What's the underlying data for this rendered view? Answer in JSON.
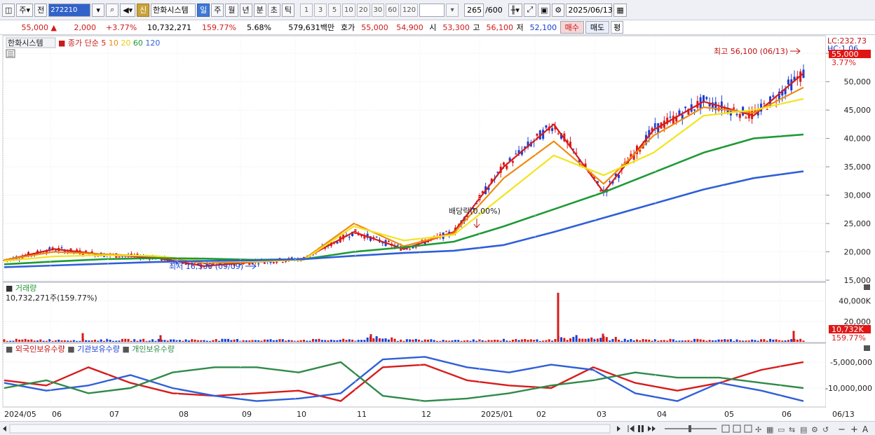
{
  "toolbar": {
    "layout_label": "주",
    "prev_label": "전",
    "stock_code": "272210",
    "shin_label": "신",
    "stock_name": "한화시스템",
    "periods": [
      "일",
      "주",
      "월",
      "년",
      "분",
      "초",
      "틱"
    ],
    "selected_period": "일",
    "minute_options": [
      "1",
      "3",
      "5",
      "10",
      "20",
      "30",
      "60",
      "120"
    ],
    "count": "265",
    "max_count": "/600",
    "date": "2025/06/13"
  },
  "quote": {
    "price": "55,000",
    "change": "2,000",
    "change_pct": "+3.77%",
    "volume": "10,732,271",
    "volume_pct": "159.77%",
    "turnover_rate": "5.68%",
    "amount": "579,631백만",
    "bid_ask_label": "호가",
    "ask": "55,000",
    "bid": "54,900",
    "open_label": "시",
    "open": "53,300",
    "high_label": "고",
    "high": "56,100",
    "low_label": "저",
    "low": "52,100",
    "buy_label": "매수",
    "sell_label": "매도",
    "eval_label": "평"
  },
  "price_panel": {
    "stock_label": "한화시스템",
    "ma_label": "종가 단순",
    "ma_periods": [
      "5",
      "10",
      "20",
      "60",
      "120"
    ],
    "ma_colors": [
      "#d81b1b",
      "#ef8a12",
      "#f2e41c",
      "#1e9a36",
      "#2f5fd8"
    ],
    "lc_label": "LC:232.73",
    "hc_label": "HC:1.06",
    "current_price_tag": "55,000",
    "current_pct_tag": "3.77%",
    "high_annotation": "최고 56,100 (06/13)",
    "low_annotation": "최저 16,530 (09/09)",
    "dividend_annotation": "배당락(0.00%)"
  },
  "volume_panel": {
    "title": "거래량",
    "summary": "10,732,271주(159.77%)",
    "current_tag": "10,732K",
    "current_pct_tag": "159.77%"
  },
  "holding_panel": {
    "legend": [
      "외국인보유수량",
      "기관보유수량",
      "개인보유수량"
    ],
    "colors": [
      "#d81b1b",
      "#2f5fd8",
      "#2f8a4a"
    ]
  },
  "x_labels": [
    "2024/05",
    "06",
    "07",
    "08",
    "09",
    "10",
    "11",
    "12",
    "2025/01",
    "02",
    "03",
    "04",
    "05",
    "06",
    "06/13"
  ],
  "chart_data": [
    {
      "type": "line",
      "title": "",
      "x": [
        "2024/05",
        "06",
        "07",
        "08",
        "09",
        "10",
        "11",
        "12",
        "2025/01",
        "02",
        "03",
        "04",
        "05",
        "06",
        "06/13"
      ],
      "ylim": [
        15000,
        57000
      ],
      "y_ticks": [
        15000,
        20000,
        25000,
        30000,
        35000,
        40000,
        45000,
        50000,
        55000
      ],
      "y_tick_labels": [
        "15,000",
        "20,000",
        "25,000",
        "30,000",
        "35,000",
        "40,000",
        "45,000",
        "50,000",
        "55,000"
      ],
      "series": [
        {
          "name": "5",
          "values": [
            18500,
            20500,
            19500,
            19000,
            17500,
            18200,
            18800,
            23500,
            20500,
            23500,
            35000,
            42500,
            30500,
            41500,
            46500,
            44000,
            51500
          ]
        },
        {
          "name": "10",
          "values": [
            18600,
            20000,
            19600,
            19200,
            18000,
            18200,
            18700,
            25000,
            21000,
            23300,
            33000,
            39500,
            32000,
            40500,
            45500,
            44500,
            49000
          ]
        },
        {
          "name": "20",
          "values": [
            18400,
            19200,
            19400,
            19300,
            18400,
            18300,
            18600,
            24500,
            22000,
            23000,
            30000,
            37000,
            33500,
            37500,
            44000,
            45000,
            47000
          ]
        },
        {
          "name": "60",
          "values": [
            17800,
            18300,
            18700,
            18900,
            18800,
            18600,
            18700,
            20000,
            20800,
            21800,
            24500,
            27500,
            30500,
            34000,
            37500,
            40000,
            40700
          ]
        },
        {
          "name": "120",
          "values": [
            17300,
            17600,
            17900,
            18200,
            18400,
            18500,
            18700,
            19300,
            19800,
            20200,
            21200,
            23500,
            26000,
            28500,
            31000,
            33000,
            34200
          ]
        }
      ],
      "high": 56100,
      "low": 16530
    },
    {
      "type": "bar",
      "title": "",
      "ylim": [
        0,
        50000
      ],
      "y_ticks": [
        20000,
        40000
      ],
      "y_tick_labels": [
        "20,000",
        "40,000K"
      ],
      "spikes": [
        {
          "x": "2024/06",
          "value": 8500
        },
        {
          "x": "2024/07",
          "value": 6500
        },
        {
          "x": "2024/11",
          "value": 7500
        },
        {
          "x": "2025/02",
          "value": 48000
        },
        {
          "x": "2025/03",
          "value": 8000
        },
        {
          "x": "2025/06/13",
          "value": 10732
        }
      ]
    },
    {
      "type": "line",
      "title": "",
      "ylim": [
        -13500,
        -3000
      ],
      "y_ticks": [
        -5000000,
        -10000000
      ],
      "y_tick_labels": [
        "-5,000,000",
        "-10,000,000"
      ],
      "series": [
        {
          "name": "외국인보유수량",
          "values": [
            -8.5,
            -9.5,
            -6.0,
            -9.0,
            -11.0,
            -11.5,
            -11.0,
            -10.5,
            -12.5,
            -6.0,
            -5.5,
            -8.5,
            -9.5,
            -10.0,
            -6.0,
            -9.0,
            -10.5,
            -9.0,
            -6.5,
            -5.0
          ]
        },
        {
          "name": "기관보유수량",
          "values": [
            -9.0,
            -10.5,
            -9.5,
            -7.5,
            -10.0,
            -11.5,
            -12.5,
            -12.0,
            -11.0,
            -4.5,
            -4.0,
            -6.0,
            -7.0,
            -5.5,
            -6.5,
            -11.0,
            -12.5,
            -9.0,
            -10.5,
            -12.5
          ]
        },
        {
          "name": "개인보유수량",
          "values": [
            -10.0,
            -8.5,
            -11.0,
            -10.0,
            -7.0,
            -6.0,
            -6.0,
            -7.0,
            -5.0,
            -11.5,
            -12.5,
            -12.0,
            -11.0,
            -9.5,
            -8.5,
            -7.0,
            -8.0,
            -8.0,
            -9.0,
            -10.0
          ]
        }
      ]
    }
  ]
}
